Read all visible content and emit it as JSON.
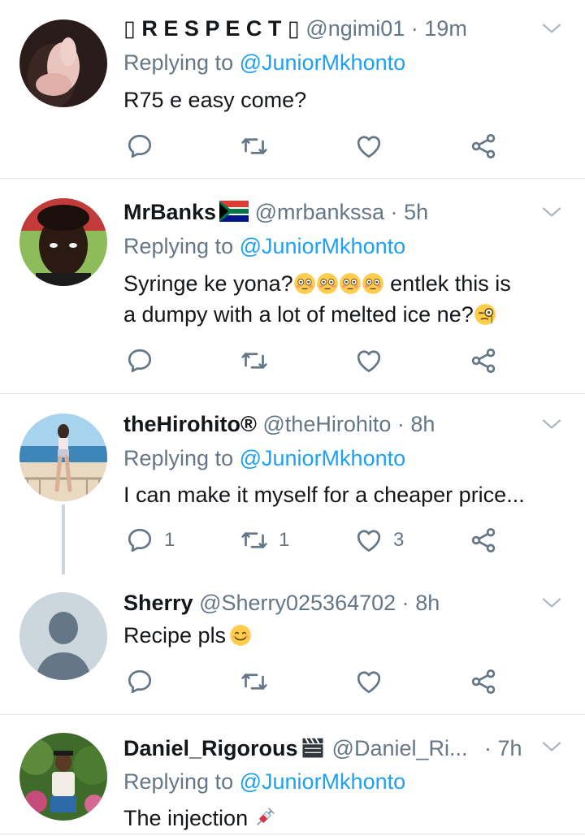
{
  "tweets": [
    {
      "name": "▯ R E S P E C T ▯",
      "handle": "@ngimi01",
      "dot": "·",
      "time": "19m",
      "reply_prefix": "Replying to",
      "reply_to": "@JuniorMkhonto",
      "text": "R75 e easy come?",
      "counts": {
        "reply": "",
        "retweet": "",
        "like": ""
      }
    },
    {
      "name": "MrBanks",
      "handle": "@mrbankssa",
      "dot": "·",
      "time": "5h",
      "reply_prefix": "Replying to",
      "reply_to": "@JuniorMkhonto",
      "text_line1": "Syringe ke yona?",
      "text_line1b": "entlek this is",
      "text_line2": "a dumpy with  a lot of melted ice ne?",
      "counts": {
        "reply": "",
        "retweet": "",
        "like": ""
      }
    },
    {
      "name": "theHirohito®",
      "handle": "@theHirohito",
      "dot": "·",
      "time": "8h",
      "reply_prefix": "Replying to",
      "reply_to": "@JuniorMkhonto",
      "text": "I can make it myself for a cheaper price...",
      "counts": {
        "reply": "1",
        "retweet": "1",
        "like": "3"
      }
    },
    {
      "name": "Sherry",
      "handle": "@Sherry025364702",
      "dot": "·",
      "time": "8h",
      "text": "Recipe  pls",
      "counts": {
        "reply": "",
        "retweet": "",
        "like": ""
      }
    },
    {
      "name": "Daniel_Rigorous",
      "handle": "@Daniel_Ri...",
      "dot": "·",
      "time": "7h",
      "reply_prefix": "Replying to",
      "reply_to": "@JuniorMkhonto",
      "text": "The injection",
      "counts": {
        "reply": "",
        "retweet": "",
        "like": ""
      }
    }
  ],
  "colors": {
    "text": "#14171a",
    "secondary": "#657786",
    "link": "#1da1f2",
    "divider": "#e1e8ed"
  },
  "icons": [
    "reply-icon",
    "retweet-icon",
    "like-icon",
    "share-icon",
    "chevron-down-icon"
  ]
}
